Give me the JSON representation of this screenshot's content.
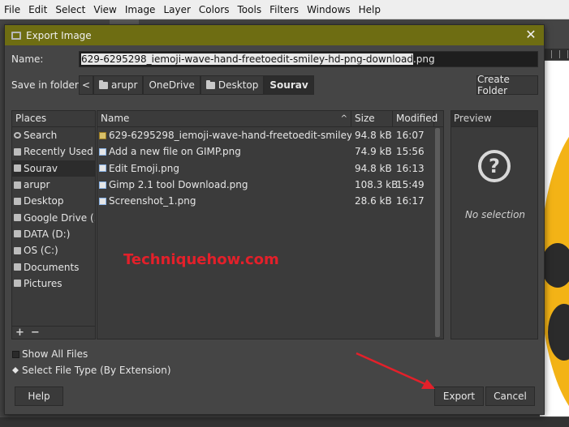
{
  "menubar": {
    "items": [
      "File",
      "Edit",
      "Select",
      "View",
      "Image",
      "Layer",
      "Colors",
      "Tools",
      "Filters",
      "Windows",
      "Help"
    ]
  },
  "dialog": {
    "title": "Export Image",
    "name_label": "Name:",
    "name_selected": "629-6295298_iemoji-wave-hand-freetoedit-smiley-hd-png-download",
    "name_ext": ".png",
    "save_in_label": "Save in folder:",
    "breadcrumbs": [
      "arupr",
      "OneDrive",
      "Desktop",
      "Sourav"
    ],
    "create_folder": "Create Folder"
  },
  "places": {
    "header": "Places",
    "items": [
      {
        "label": "Search",
        "icon": "search-icon"
      },
      {
        "label": "Recently Used",
        "icon": "recent-icon"
      },
      {
        "label": "Sourav",
        "icon": "folder-icon"
      },
      {
        "label": "arupr",
        "icon": "folder-icon"
      },
      {
        "label": "Desktop",
        "icon": "folder-icon"
      },
      {
        "label": "Google Drive (...",
        "icon": "drive-icon"
      },
      {
        "label": "DATA (D:)",
        "icon": "drive-icon"
      },
      {
        "label": "OS (C:)",
        "icon": "drive-icon"
      },
      {
        "label": "Documents",
        "icon": "folder-icon"
      },
      {
        "label": "Pictures",
        "icon": "folder-icon"
      }
    ],
    "add": "+",
    "remove": "−"
  },
  "files": {
    "columns": [
      "Name",
      "Size",
      "Modified"
    ],
    "rows": [
      {
        "name": "629-6295298_iemoji-wave-hand-freetoedit-smiley-hd-p...",
        "size": "94.8 kB",
        "modified": "16:07"
      },
      {
        "name": "Add a new file on GIMP.png",
        "size": "74.9 kB",
        "modified": "15:56"
      },
      {
        "name": "Edit Emoji.png",
        "size": "94.8 kB",
        "modified": "16:13"
      },
      {
        "name": "Gimp 2.1 tool Download.png",
        "size": "108.3 kB",
        "modified": "15:49"
      },
      {
        "name": "Screenshot_1.png",
        "size": "28.6 kB",
        "modified": "16:17"
      }
    ]
  },
  "preview": {
    "header": "Preview",
    "icon": "?",
    "text": "No selection"
  },
  "options": {
    "show_all": "Show All Files",
    "file_type": "Select File Type (By Extension)"
  },
  "buttons": {
    "help": "Help",
    "export": "Export",
    "cancel": "Cancel"
  },
  "watermark": "Techniquehow.com",
  "colors": {
    "titlebar": "#6e6d12",
    "arrow": "#e3202a"
  }
}
